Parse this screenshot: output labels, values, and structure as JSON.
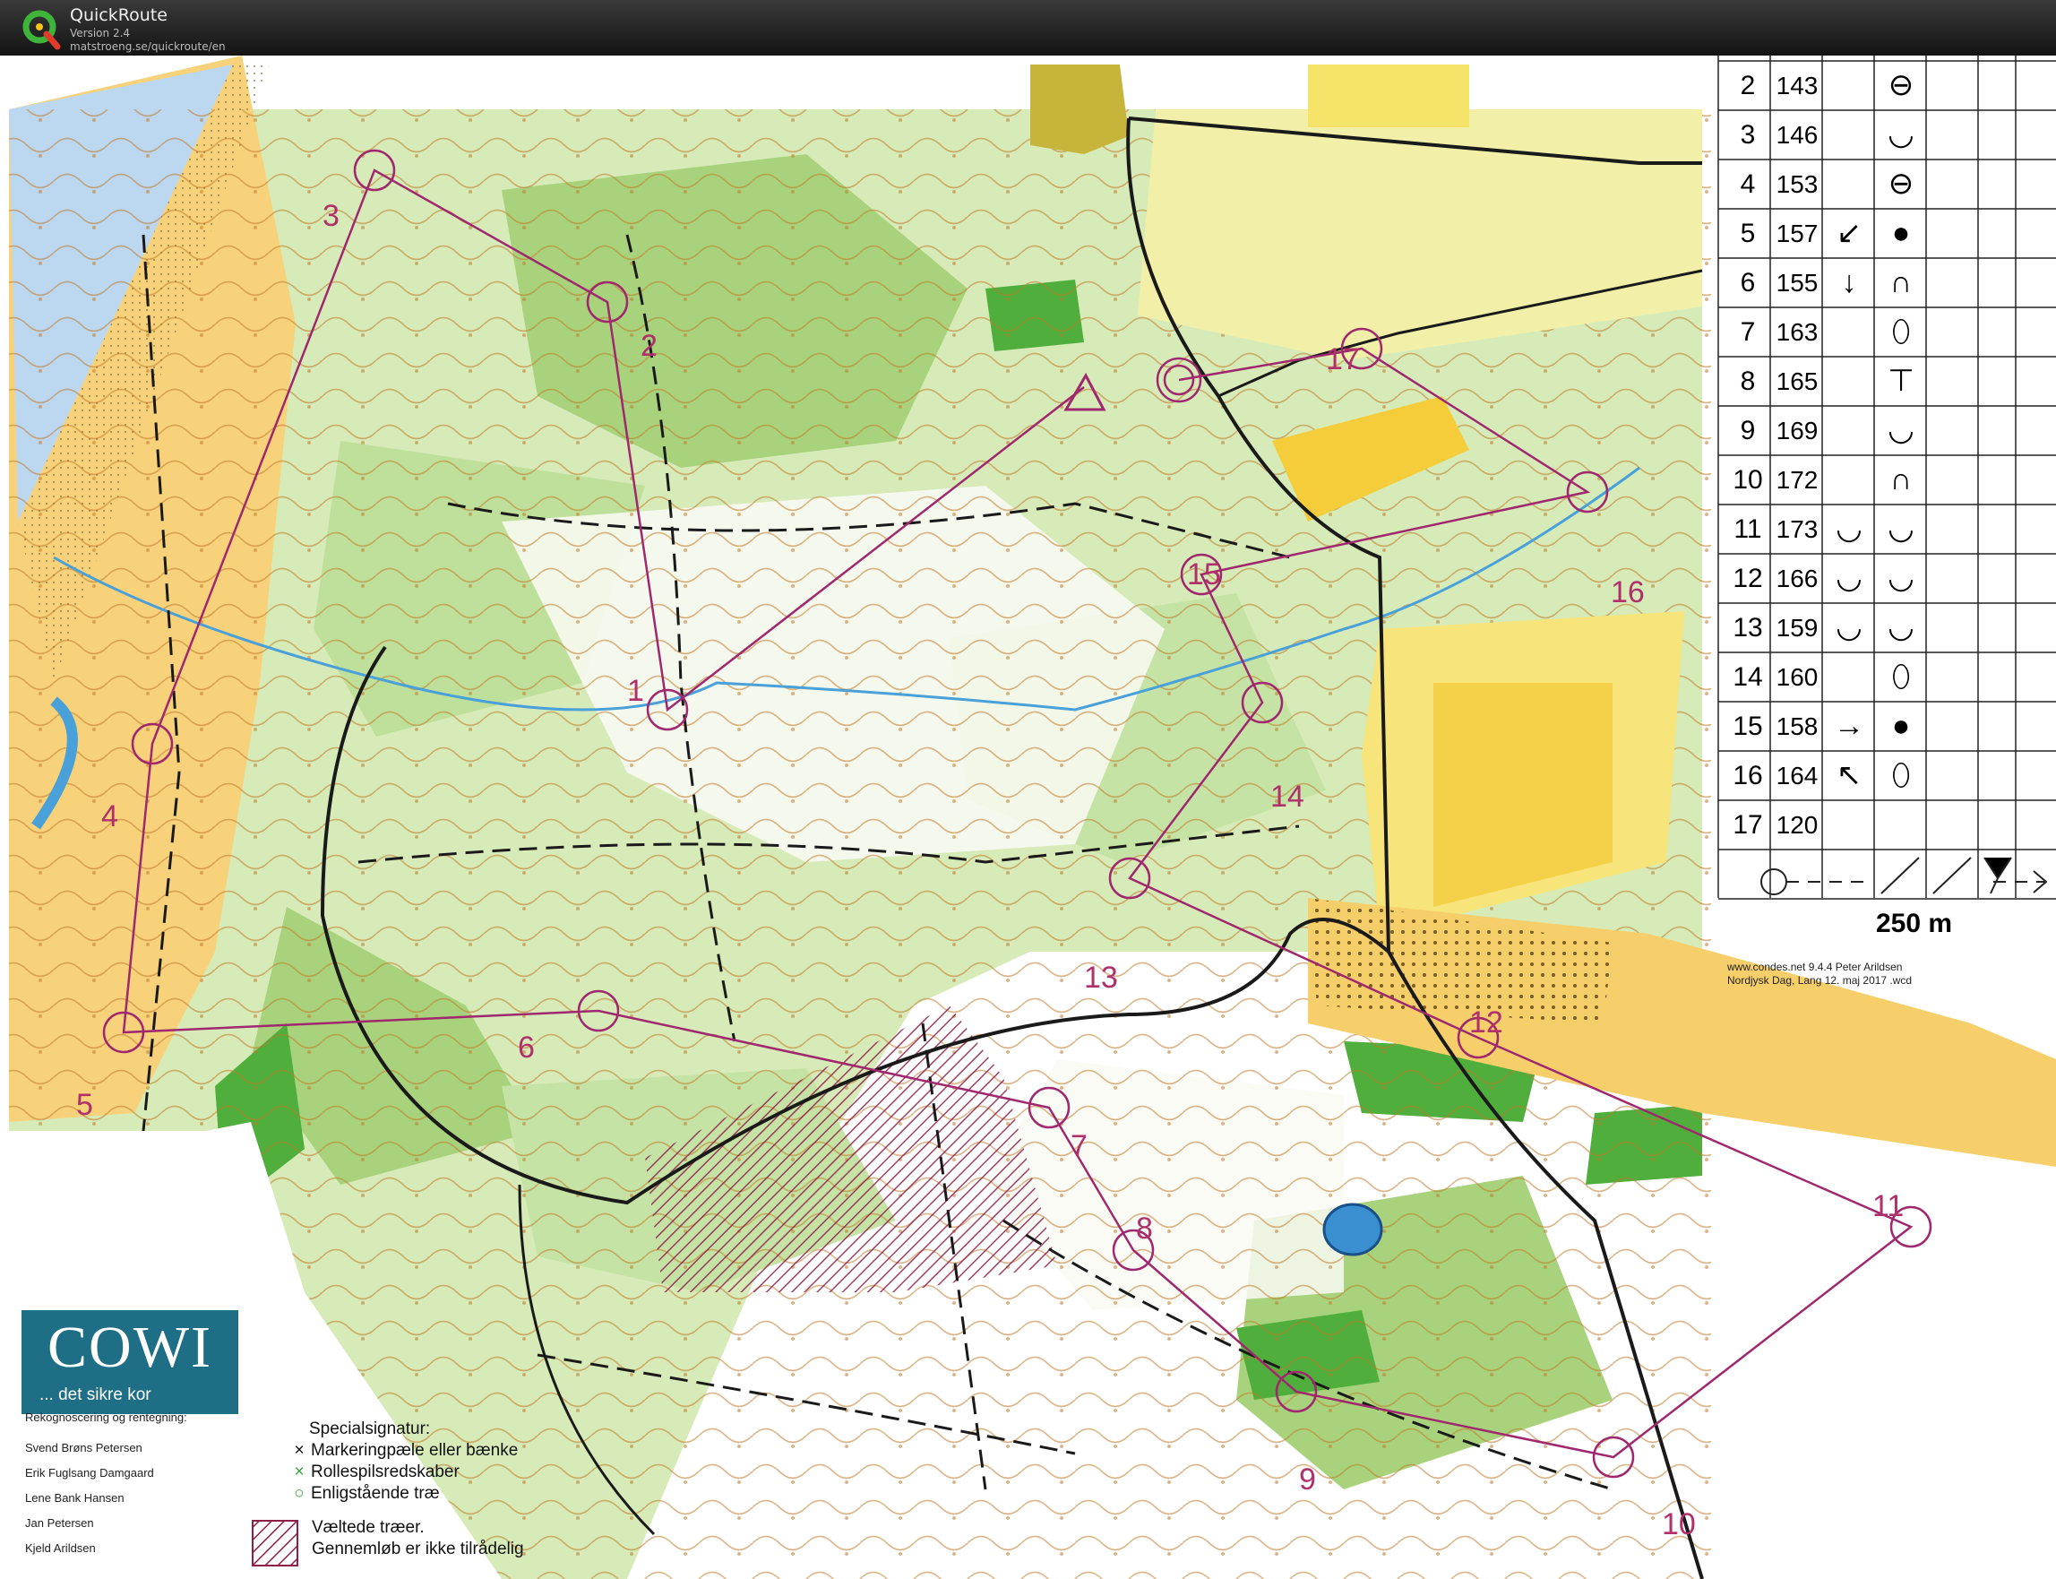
{
  "app": {
    "name": "QuickRoute",
    "version": "Version 2.4",
    "url": "matstroeng.se/quickroute/en"
  },
  "course": {
    "line_color": "#a0286e",
    "control_labels": [
      "1",
      "2",
      "3",
      "4",
      "5",
      "6",
      "7",
      "8",
      "9",
      "10",
      "11",
      "12",
      "13",
      "14",
      "15",
      "16",
      "17"
    ]
  },
  "description_table": {
    "rows": [
      {
        "num": "2",
        "code": "143",
        "sym1": "",
        "sym2": "⊖"
      },
      {
        "num": "3",
        "code": "146",
        "sym1": "",
        "sym2": "◡"
      },
      {
        "num": "4",
        "code": "153",
        "sym1": "",
        "sym2": "⊖"
      },
      {
        "num": "5",
        "code": "157",
        "sym1": "↙",
        "sym2": "●"
      },
      {
        "num": "6",
        "code": "155",
        "sym1": "↓",
        "sym2": "∩"
      },
      {
        "num": "7",
        "code": "163",
        "sym1": "",
        "sym2": "⬯"
      },
      {
        "num": "8",
        "code": "165",
        "sym1": "",
        "sym2": "⊤"
      },
      {
        "num": "9",
        "code": "169",
        "sym1": "",
        "sym2": "◡"
      },
      {
        "num": "10",
        "code": "172",
        "sym1": "",
        "sym2": "∩"
      },
      {
        "num": "11",
        "code": "173",
        "sym1": "◡",
        "sym2": "◡"
      },
      {
        "num": "12",
        "code": "166",
        "sym1": "◡",
        "sym2": "◡"
      },
      {
        "num": "13",
        "code": "159",
        "sym1": "◡",
        "sym2": "◡"
      },
      {
        "num": "14",
        "code": "160",
        "sym1": "",
        "sym2": "⬯"
      },
      {
        "num": "15",
        "code": "158",
        "sym1": "→",
        "sym2": "●"
      },
      {
        "num": "16",
        "code": "164",
        "sym1": "↖",
        "sym2": "⬯"
      },
      {
        "num": "17",
        "code": "120",
        "sym1": "",
        "sym2": ""
      }
    ],
    "scale": "250 m",
    "credit_line1": "www.condes.net 9.4.4 Peter Arildsen",
    "credit_line2": "Nordjysk Dag, Lang 12. maj 2017 .wcd"
  },
  "sponsor": {
    "name": "COWI",
    "slogan": "... det sikre kor"
  },
  "survey": {
    "title": "Rekognoscering og rentegning:",
    "names": [
      "Svend Brøns Petersen",
      "Erik Fuglsang Damgaard",
      "Lene Bank Hansen",
      "Jan Petersen",
      "Kjeld Arildsen"
    ]
  },
  "legend": {
    "title": "Specialsignatur:",
    "items": [
      {
        "symbol": "×",
        "color": "#111111",
        "label": "Markeringpæle eller bænke"
      },
      {
        "symbol": "×",
        "color": "#3aa33a",
        "label": "Rollespilsredskaber"
      },
      {
        "symbol": "○",
        "color": "#3aa33a",
        "label": "Enligstående træ"
      }
    ],
    "fallen_line1": "Væltede træer.",
    "fallen_line2": "Gennemløb er ikke tilrådelig",
    "fallen_color": "#8e1e4a"
  },
  "colors": {
    "forest_light": "#d6ebb8",
    "forest_mid": "#a9d27c",
    "forest_dark": "#4fae3c",
    "open_yellow": "#f7e47a",
    "rough_yellow": "#f2f0a8",
    "contour": "#c07a2a",
    "water": "#4aa0d8",
    "road": "#1a1a1a"
  }
}
